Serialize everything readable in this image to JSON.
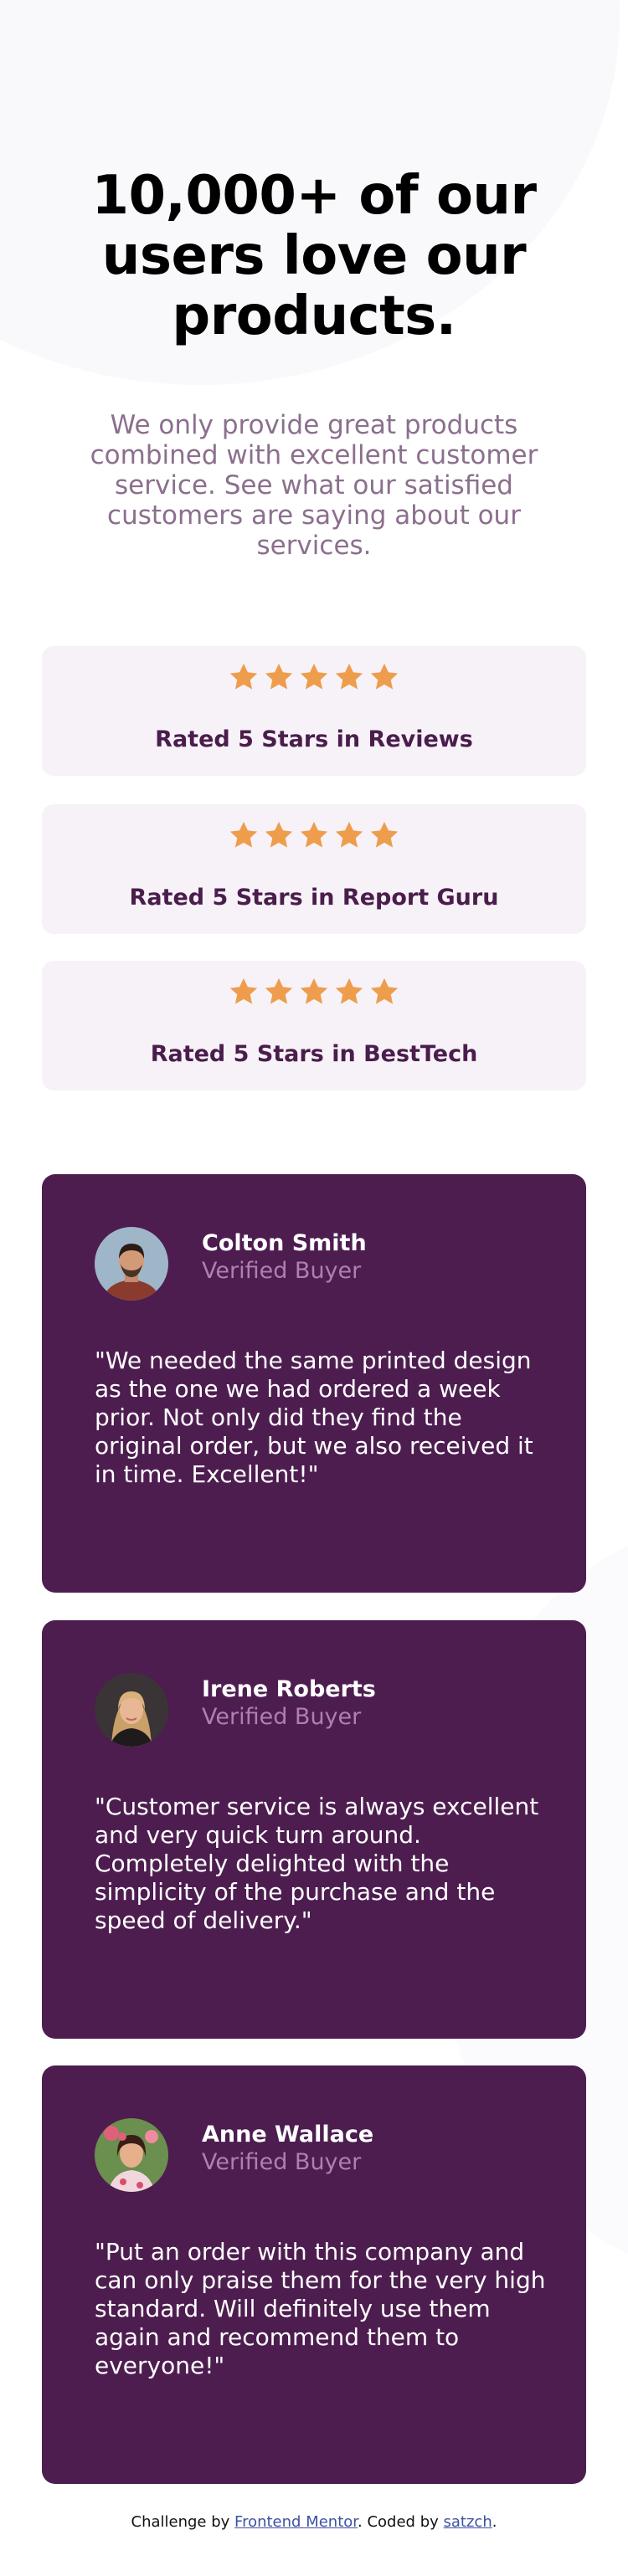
{
  "header": {
    "title": "10,000+ of our users love our products.",
    "intro": "We only provide great products combined with excellent customer service. See what our satisfied customers are saying about our services."
  },
  "ratings": [
    {
      "label": "Rated 5 Stars in Reviews",
      "stars": 5
    },
    {
      "label": "Rated 5 Stars in Report Guru",
      "stars": 5
    },
    {
      "label": "Rated 5 Stars in BestTech",
      "stars": 5
    }
  ],
  "testimonials": [
    {
      "name": "Colton Smith",
      "role": "Verified Buyer",
      "quote": "\"We needed the same printed design as the one we had ordered a week prior. Not only did they find the original order, but we also received it in time. Excellent!\""
    },
    {
      "name": "Irene Roberts",
      "role": "Verified Buyer",
      "quote": "\"Customer service is always excellent and very quick turn around. Completely delighted with the simplicity of the purchase and the speed of delivery.\""
    },
    {
      "name": "Anne Wallace",
      "role": "Verified Buyer",
      "quote": "\"Put an order with this company and can only praise them for the very high standard. Will definitely use them again and recommend them to everyone!\""
    }
  ],
  "footer": {
    "prefix": "Challenge by ",
    "link1": "Frontend Mentor",
    "middle": ". Coded by ",
    "link2": "satzch",
    "suffix": "."
  },
  "colors": {
    "star": "#ee9d4d",
    "rating_bg": "#f7f2f8",
    "card_bg": "#4d1d50",
    "heading": "#000000",
    "intro_text": "#8b6f8d",
    "rating_text": "#4a1d4c",
    "role_text": "#b07fb2",
    "link": "#3e52a3"
  },
  "icons": [
    "star-icon",
    "avatar-colton",
    "avatar-irene",
    "avatar-anne"
  ]
}
